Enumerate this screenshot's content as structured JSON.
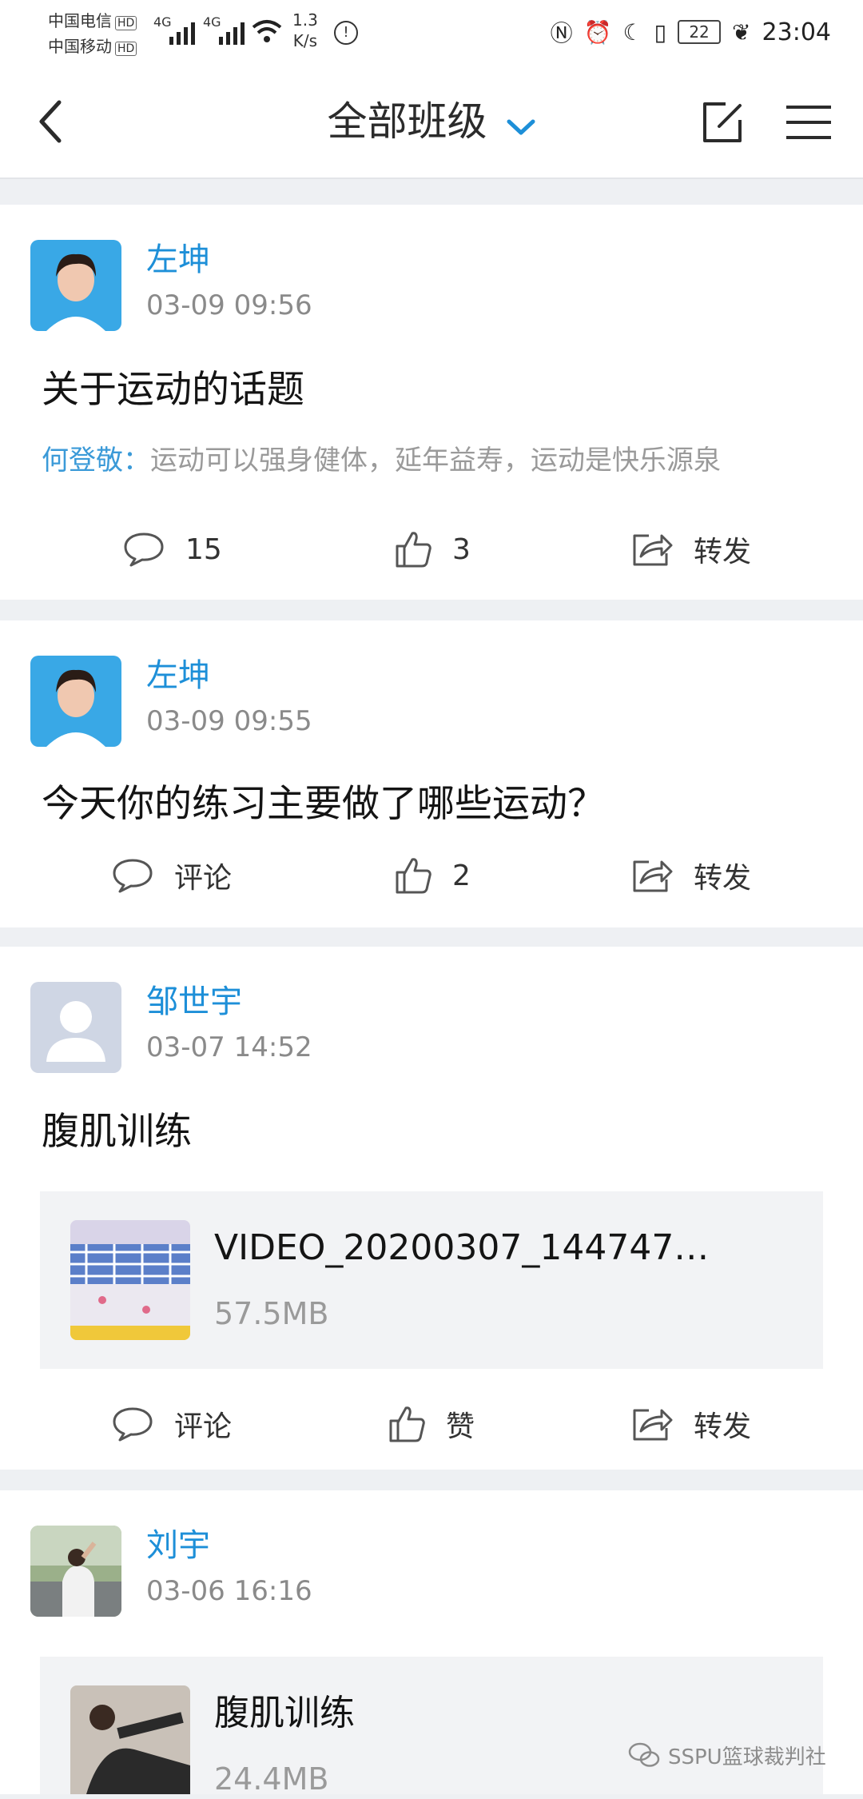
{
  "status_bar": {
    "carrier_1": "中国电信",
    "carrier_2": "中国移动",
    "hd_badge": "HD",
    "network_1": "4G",
    "network_2": "4G",
    "speed_value": "1.3",
    "speed_unit": "K/s",
    "battery": "22",
    "time": "23:04"
  },
  "header": {
    "title": "全部班级",
    "accent_color": "#1d8fd8"
  },
  "posts": [
    {
      "author": "左坤",
      "time": "03-09 09:56",
      "text": "关于运动的话题",
      "comment_author": "何登敬：",
      "comment_text": "运动可以强身健体，延年益寿，运动是快乐源泉",
      "comment_count": "15",
      "like_count": "3",
      "share_label": "转发"
    },
    {
      "author": "左坤",
      "time": "03-09 09:55",
      "text": "今天你的练习主要做了哪些运动？",
      "comment_label": "评论",
      "like_count": "2",
      "share_label": "转发"
    },
    {
      "author": "邹世宇",
      "time": "03-07 14:52",
      "text": "腹肌训练",
      "attachment_name": "VIDEO_20200307_144747…",
      "attachment_size": "57.5MB",
      "comment_label": "评论",
      "like_label": "赞",
      "share_label": "转发"
    },
    {
      "author": "刘宇",
      "time": "03-06 16:16",
      "attachment_name": "腹肌训练",
      "attachment_size": "24.4MB"
    }
  ],
  "watermark": "SSPU篮球裁判社"
}
